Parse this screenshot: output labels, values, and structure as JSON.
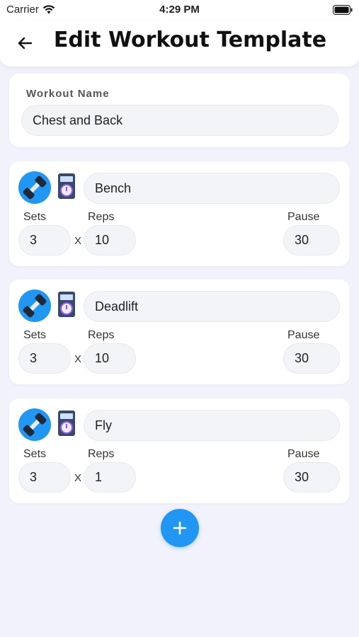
{
  "status_bar": {
    "carrier": "Carrier",
    "time": "4:29 PM"
  },
  "header": {
    "title": "Edit Workout Template"
  },
  "workout": {
    "name_label": "Workout Name",
    "name_value": "Chest and Back"
  },
  "labels": {
    "sets": "Sets",
    "reps": "Reps",
    "pause": "Pause",
    "times": "X"
  },
  "exercises": [
    {
      "name": "Bench",
      "sets": "3",
      "reps": "10",
      "pause": "30"
    },
    {
      "name": "Deadlift",
      "sets": "3",
      "reps": "10",
      "pause": "30"
    },
    {
      "name": "Fly",
      "sets": "3",
      "reps": "1",
      "pause": "30"
    }
  ],
  "colors": {
    "accent": "#2196f3",
    "background": "#f1f2fb",
    "card": "#ffffff"
  },
  "icons": [
    "back-arrow-icon",
    "dumbbell-icon",
    "timer-icon",
    "plus-icon"
  ]
}
